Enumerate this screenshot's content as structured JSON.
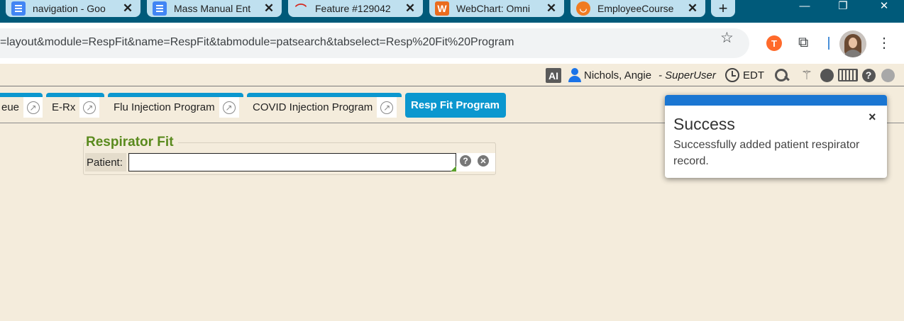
{
  "browser": {
    "tabs": [
      {
        "title": "navigation - Goo",
        "icon": "google-docs-icon"
      },
      {
        "title": "Mass Manual Ent",
        "icon": "google-docs-icon"
      },
      {
        "title": "Feature #129042",
        "icon": "redmine-icon"
      },
      {
        "title": "WebChart: Omni",
        "icon": "webchart-icon"
      },
      {
        "title": "EmployeeCourse",
        "icon": "employee-course-icon"
      }
    ],
    "new_tab": "+",
    "url": "=layout&module=RespFit&name=RespFit&tabmodule=patsearch&tabselect=Resp%20Fit%20Program",
    "window_controls": {
      "minimize": "—",
      "restore": "❐",
      "close": "✕"
    },
    "colors": {
      "tab_strip": "#005a7a",
      "tab": "#bfe0ef"
    }
  },
  "userbar": {
    "ai_badge": "AI",
    "user_name": "Nichols, Angie",
    "role": "- SuperUser",
    "timezone": "EDT"
  },
  "module_tabs": [
    {
      "label": "eue",
      "active": false
    },
    {
      "label": "E-Rx",
      "active": false
    },
    {
      "label": "Flu Injection Program",
      "active": false
    },
    {
      "label": "COVID Injection Program",
      "active": false
    },
    {
      "label": "Resp Fit Program",
      "active": true
    }
  ],
  "respirator_fit": {
    "title": "Respirator Fit",
    "patient_label": "Patient:",
    "patient_value": ""
  },
  "toast": {
    "title": "Success",
    "message": "Successfully added patient respirator record.",
    "close": "×",
    "accent": "#1a76d2"
  },
  "colors": {
    "page_bg": "#f4ecdc",
    "tab_accent": "#0b97cf",
    "title_green": "#5a8a1e"
  }
}
